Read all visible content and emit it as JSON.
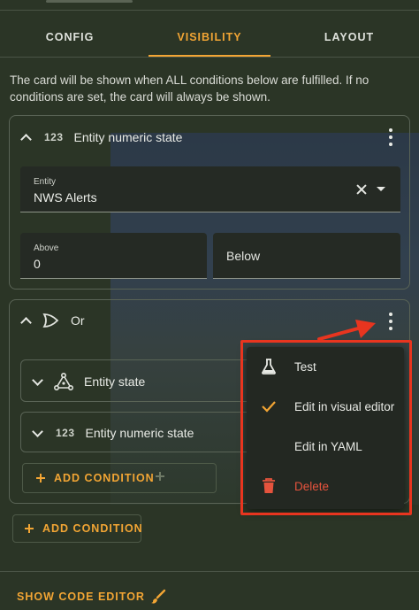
{
  "tabs": [
    {
      "label": "CONFIG",
      "active": false
    },
    {
      "label": "VISIBILITY",
      "active": true
    },
    {
      "label": "LAYOUT",
      "active": false
    }
  ],
  "intro_text": "The card will be shown when ALL conditions below are fulfilled. If no conditions are set, the card will always be shown.",
  "condition1": {
    "icon_text": "123",
    "title": "Entity numeric state",
    "entity_field": {
      "label": "Entity",
      "value": "NWS Alerts"
    },
    "above_field": {
      "label": "Above",
      "value": "0"
    },
    "below_field": {
      "label": "Below"
    }
  },
  "condition2": {
    "title": "Or",
    "sub_conditions": [
      {
        "title": "Entity state",
        "icon": "entity-state-icon"
      },
      {
        "icon_text": "123",
        "title": "Entity numeric state",
        "icon": "numeric-icon"
      }
    ],
    "add_condition_label": "ADD CONDITION"
  },
  "add_condition_label": "ADD CONDITION",
  "show_code_editor_label": "SHOW CODE EDITOR",
  "context_menu": {
    "items": [
      {
        "label": "Test",
        "icon": "flask-icon"
      },
      {
        "label": "Edit in visual editor",
        "icon": "check-icon",
        "checked": true
      },
      {
        "label": "Edit in YAML",
        "icon": ""
      },
      {
        "label": "Delete",
        "icon": "trash-icon",
        "danger": true
      }
    ]
  },
  "colors": {
    "accent": "#f2a534",
    "danger": "#e5533d",
    "highlight_frame": "#e8351f",
    "background": "#2b3526"
  }
}
